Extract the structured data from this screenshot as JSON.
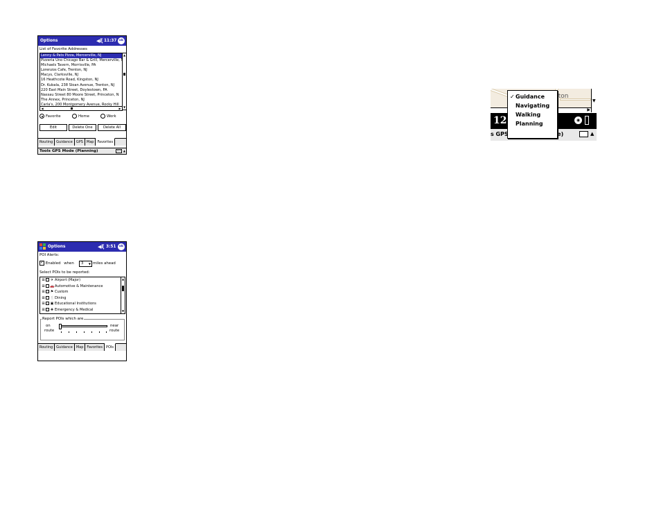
{
  "screen1": {
    "title": "Options",
    "time": "11:37",
    "ok": "ok",
    "list_label": "List of Favorite Addresses",
    "addresses": [
      "Lenny & Pats Pizza, Mercerville, NJ",
      "Pizzeria Uno Chicago Bar & Grill, Mercerville, N",
      "Michaels Tavern, Morrisville, PA",
      "Lorenzos Cafe, Trenton, NJ",
      "Macys, Clarksville, NJ",
      "16 Heathcote Road, Kingston, NJ",
      "Dr. Kubala, 238 Sloan Avenue, Trenton, NJ",
      "220 East Main Street, Doylestown, PA",
      "Nassau Street 80 Moore Street, Princeton, N",
      "The Annex, Princeton, NJ",
      "Carla's, 200 Montgomery Avenue, Rocky Hill"
    ],
    "selected_index": 0,
    "radios": [
      {
        "label": "Favorite",
        "checked": true
      },
      {
        "label": "Home",
        "checked": false
      },
      {
        "label": "Work",
        "checked": false
      }
    ],
    "buttons": {
      "edit": "Edit",
      "delete_one": "Delete One",
      "delete_all": "Delete All"
    },
    "tabs": [
      "Routing",
      "Guidance",
      "GPS",
      "Map",
      "Favorites"
    ],
    "active_tab": "Favorites",
    "command_bar": "Tools GPS Mode (Planning)"
  },
  "screen2": {
    "title": "Options",
    "time": "3:51",
    "ok": "ok",
    "section_label": "POI Alerts:",
    "enabled_label": "Enabled",
    "enabled_checked": true,
    "when_label": "when",
    "miles_value": "3",
    "miles_suffix": "miles ahead",
    "select_label": "Select POIs to be reported:",
    "pois": [
      {
        "name": "Airport (Major)",
        "icon": "airplane-icon",
        "glyph": "✈"
      },
      {
        "name": "Automotive & Maintenance",
        "icon": "car-icon",
        "glyph": "🚗"
      },
      {
        "name": "Custom",
        "icon": "flag-icon",
        "glyph": "⚑"
      },
      {
        "name": "Dining",
        "icon": "dining-icon",
        "glyph": "🍴"
      },
      {
        "name": "Educational Institutions",
        "icon": "school-icon",
        "glyph": "▣"
      },
      {
        "name": "Emergency & Medical",
        "icon": "medical-cross-icon",
        "glyph": "✚"
      }
    ],
    "report_label": "Report POIs which are",
    "slider_left_1": "on",
    "slider_left_2": "route",
    "slider_right_1": "near",
    "slider_right_2": "route",
    "slider_value": 0,
    "tabs": [
      "Routing",
      "Guidance",
      "Map",
      "Favorites",
      "POIs"
    ],
    "active_tab": "POIs"
  },
  "crop": {
    "map_label": "ston",
    "status_big": "12 a",
    "command_text": "s GPS Mode (Guidance)",
    "menu": [
      {
        "label": "Guidance",
        "checked": true
      },
      {
        "label": "Navigating",
        "checked": false
      },
      {
        "label": "Walking",
        "checked": false
      },
      {
        "label": "Planning",
        "checked": false
      }
    ]
  },
  "colors": {
    "title_bar": "#2c2cb0",
    "selection": "#2c2cb0",
    "bar_gray": "#e8e8e8"
  }
}
